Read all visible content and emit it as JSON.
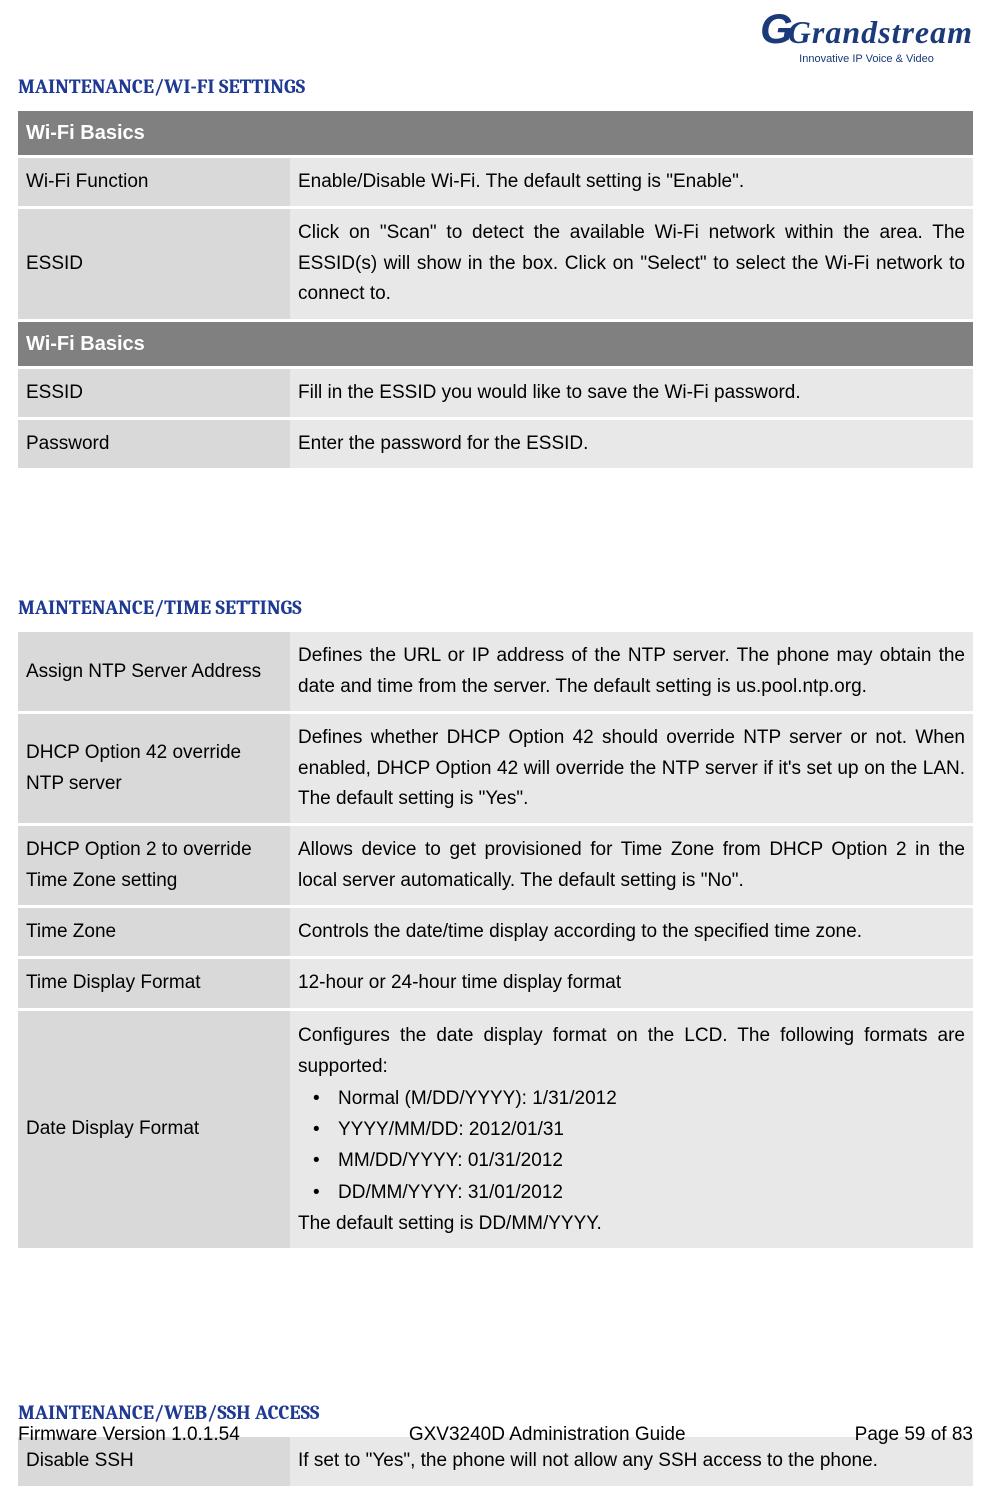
{
  "logo": {
    "brand": "Grandstream",
    "tagline": "Innovative IP Voice & Video"
  },
  "sections": {
    "wifi": {
      "heading": "MAINTENANCE/WI-FI SETTINGS",
      "header1": "Wi-Fi Basics",
      "rows1": [
        {
          "label": "Wi-Fi Function",
          "desc": "Enable/Disable Wi-Fi. The default setting is \"Enable\"."
        },
        {
          "label": "ESSID",
          "desc": "Click on \"Scan\" to detect the available Wi-Fi network within the area. The ESSID(s) will show in the box. Click on \"Select\" to select the Wi-Fi network to connect to."
        }
      ],
      "header2": "Wi-Fi Basics",
      "rows2": [
        {
          "label": "ESSID",
          "desc": "Fill in the ESSID you would like to save the Wi-Fi password."
        },
        {
          "label": "Password",
          "desc": "Enter the password for the ESSID."
        }
      ]
    },
    "time": {
      "heading": "MAINTENANCE/TIME SETTINGS",
      "rows": [
        {
          "label": "Assign NTP Server Address",
          "desc": "Defines the URL or IP address of the NTP server. The phone may obtain the date and time from the server. The default setting is us.pool.ntp.org."
        },
        {
          "label": "DHCP Option 42 override NTP server",
          "desc": "Defines whether DHCP Option 42 should override NTP server or not. When enabled, DHCP Option 42 will override the NTP server if it's set up on the LAN. The default setting is \"Yes\"."
        },
        {
          "label": "DHCP Option 2 to override Time Zone setting",
          "desc": "Allows device to get provisioned for Time Zone from DHCP Option 2 in the local server automatically. The default setting is \"No\"."
        },
        {
          "label": "Time Zone",
          "desc": "Controls the date/time display according to the specified time zone."
        },
        {
          "label": "Time Display Format",
          "desc": "12-hour or 24-hour time display format"
        }
      ],
      "dateFormat": {
        "label": "Date Display Format",
        "intro": "Configures the date display format on the LCD. The following formats are supported:",
        "bullets": [
          "Normal (M/DD/YYYY): 1/31/2012",
          "YYYY/MM/DD: 2012/01/31",
          "MM/DD/YYYY: 01/31/2012",
          "DD/MM/YYYY: 31/01/2012"
        ],
        "outro": "The default setting is DD/MM/YYYY."
      }
    },
    "webssh": {
      "heading": "MAINTENANCE/WEB/SSH ACCESS",
      "rows": [
        {
          "label": "Disable SSH",
          "desc": "If set to \"Yes\", the phone will not allow any SSH access to the phone."
        }
      ]
    }
  },
  "footer": {
    "left": "Firmware Version 1.0.1.54",
    "center": "GXV3240D Administration Guide",
    "right": "Page 59 of 83"
  }
}
